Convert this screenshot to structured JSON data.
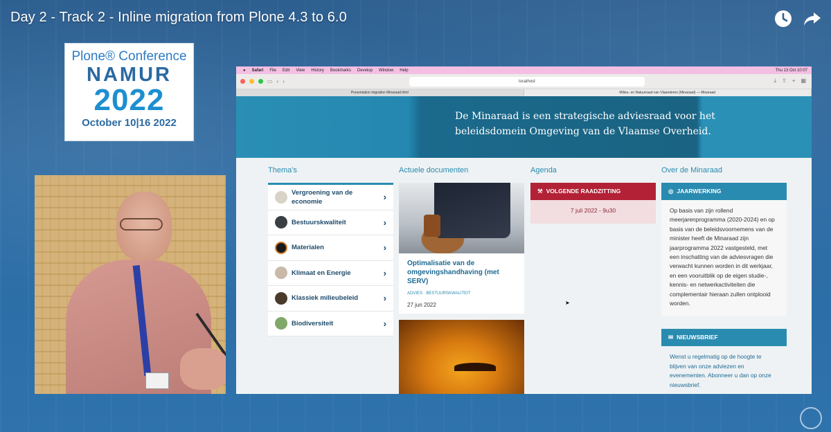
{
  "video": {
    "title": "Day 2 - Track 2 - Inline migration from Plone 4.3 to 6.0",
    "icons": [
      "clock-icon",
      "share-icon"
    ]
  },
  "logo": {
    "top": "Plone® Conference",
    "city": "NAMUR",
    "year": "2022",
    "date": "October 10|16 2022"
  },
  "mac_menu": {
    "apple": "",
    "app": "Safari",
    "items": [
      "File",
      "Edit",
      "View",
      "History",
      "Bookmarks",
      "Develop",
      "Window",
      "Help"
    ],
    "clock": "Thu 13 Oct 10:07"
  },
  "browser": {
    "url": "localhost",
    "tabs": [
      "Presentation migration Minaraad.html",
      "Milieu- en Natuurraad van Vlaanderen (Minaraad) — Minaraad"
    ]
  },
  "site": {
    "hero_text": "De Minaraad is een strategische adviesraad voor het beleidsdomein Omgeving van de Vlaamse Overheid.",
    "themas": {
      "title": "Thema's",
      "items": [
        "Vergroening van de economie",
        "Bestuurskwaliteit",
        "Materialen",
        "Klimaat en Energie",
        "Klassiek milieubeleid",
        "Biodiversiteit"
      ]
    },
    "documenten": {
      "title": "Actuele documenten",
      "doc_title": "Optimalisatie van de omgevingshandhaving (met SERV)",
      "tags": "ADVIES · BESTUURSKWALITEIT",
      "date": "27 jun 2022"
    },
    "agenda": {
      "title": "Agenda",
      "head": "VOLGENDE RAADZITTING",
      "date": "7 juli 2022 - 9u30"
    },
    "over": {
      "title": "Over de Minaraad",
      "jaarwerking_head": "JAARWERKING",
      "jaarwerking_text": "Op basis van zijn rollend meerjarenprogramma (2020-2024) en op basis van de beleidsvoornemens van de minister heeft de Minaraad zijn jaarprogramma 2022 vastgesteld, met een inschatting van de adviesvragen die verwacht kunnen worden in dit werkjaar, en een vooruitblik op de eigen studie-, kennis- en netwerkactiviteiten die complementair hieraan zullen ontplooid worden.",
      "nieuwsbrief_head": "NIEUWSBRIEF",
      "nieuwsbrief_text": "Wenst u regelmatig op de hoogte te blijven van onze adviezen en evenementen. Abonneer u dan op onze nieuwsbrief."
    }
  },
  "colors": {
    "accent": "#2a8bb0",
    "agenda": "#b22135",
    "hero": "#1a6382"
  }
}
